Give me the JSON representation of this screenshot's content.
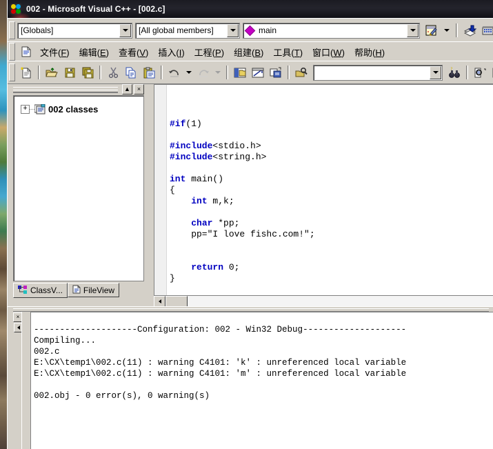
{
  "window": {
    "title": "002 - Microsoft Visual C++ - [002.c]",
    "icon": "vcpp-app-icon"
  },
  "combobar": {
    "scope_value": "[Globals]",
    "members_value": "[All global members]",
    "symbol_value": "main",
    "symbol_icon": "magenta-diamond-icon",
    "wizard_icon": "classwizard-icon",
    "arrow_icon": "chevron-down-icon"
  },
  "toolbar_right_top": {
    "buttons": [
      {
        "name": "compile-icon",
        "glyph": "compile"
      },
      {
        "name": "build-icon",
        "glyph": "build"
      },
      {
        "name": "execute-icon",
        "glyph": "execute"
      },
      {
        "name": "stop-build-icon",
        "glyph": "!"
      }
    ]
  },
  "menu": {
    "icon": "document-icon",
    "items": [
      {
        "label": "文件",
        "accel": "F"
      },
      {
        "label": "编辑",
        "accel": "E"
      },
      {
        "label": "查看",
        "accel": "V"
      },
      {
        "label": "插入",
        "accel": "I"
      },
      {
        "label": "工程",
        "accel": "P"
      },
      {
        "label": "组建",
        "accel": "B"
      },
      {
        "label": "工具",
        "accel": "T"
      },
      {
        "label": "窗口",
        "accel": "W"
      },
      {
        "label": "帮助",
        "accel": "H"
      }
    ]
  },
  "toolbar": {
    "buttons": [
      {
        "name": "new-file-icon"
      },
      {
        "name": "open-file-icon"
      },
      {
        "name": "save-icon"
      },
      {
        "name": "save-all-icon"
      },
      {
        "name": "cut-icon"
      },
      {
        "name": "copy-icon"
      },
      {
        "name": "paste-icon"
      },
      {
        "name": "undo-icon"
      },
      {
        "name": "undo-dropdown-icon"
      },
      {
        "name": "redo-icon"
      },
      {
        "name": "redo-dropdown-icon"
      },
      {
        "name": "workspace-toggle-icon"
      },
      {
        "name": "output-toggle-icon"
      },
      {
        "name": "watch-toggle-icon"
      },
      {
        "name": "find-in-files-icon"
      },
      {
        "name": "find-combo-dropdown-icon"
      },
      {
        "name": "find-binoculars-icon"
      },
      {
        "name": "breakpoint-insert-icon"
      },
      {
        "name": "breakpoint-remove-icon"
      },
      {
        "name": "bookmark-icon"
      },
      {
        "name": "properties-icon"
      }
    ],
    "find_placeholder": "",
    "find_value": ""
  },
  "workspace": {
    "close_label": "×",
    "pin_label": "▲",
    "tree": {
      "expander": "+",
      "icon": "classes-folder-icon",
      "label": "002 classes"
    },
    "tabs": [
      {
        "label": "ClassV...",
        "icon": "classview-icon",
        "active": true
      },
      {
        "label": "FileView",
        "icon": "fileview-icon",
        "active": false
      }
    ]
  },
  "editor": {
    "lines": [
      {
        "segments": [
          {
            "t": "",
            "c": "plain"
          }
        ]
      },
      {
        "segments": [
          {
            "t": "",
            "c": "plain"
          }
        ]
      },
      {
        "segments": [
          {
            "t": "#if",
            "c": "pp"
          },
          {
            "t": "(1)",
            "c": "plain"
          }
        ]
      },
      {
        "segments": [
          {
            "t": "",
            "c": "plain"
          }
        ]
      },
      {
        "segments": [
          {
            "t": "#include",
            "c": "pp"
          },
          {
            "t": "<stdio.h>",
            "c": "plain"
          }
        ]
      },
      {
        "segments": [
          {
            "t": "#include",
            "c": "pp"
          },
          {
            "t": "<string.h>",
            "c": "plain"
          }
        ]
      },
      {
        "segments": [
          {
            "t": "",
            "c": "plain"
          }
        ]
      },
      {
        "segments": [
          {
            "t": "int",
            "c": "kw"
          },
          {
            "t": " main()",
            "c": "plain"
          }
        ]
      },
      {
        "segments": [
          {
            "t": "{",
            "c": "plain"
          }
        ]
      },
      {
        "segments": [
          {
            "t": "    ",
            "c": "plain"
          },
          {
            "t": "int",
            "c": "kw"
          },
          {
            "t": " m,k;",
            "c": "plain"
          }
        ]
      },
      {
        "segments": [
          {
            "t": "",
            "c": "plain"
          }
        ]
      },
      {
        "segments": [
          {
            "t": "    ",
            "c": "plain"
          },
          {
            "t": "char",
            "c": "kw"
          },
          {
            "t": " *pp;",
            "c": "plain"
          }
        ]
      },
      {
        "segments": [
          {
            "t": "    pp=\"I love fishc.com!\";",
            "c": "plain"
          }
        ]
      },
      {
        "segments": [
          {
            "t": "",
            "c": "plain"
          }
        ]
      },
      {
        "segments": [
          {
            "t": "",
            "c": "plain"
          }
        ]
      },
      {
        "segments": [
          {
            "t": "    ",
            "c": "plain"
          },
          {
            "t": "return",
            "c": "kw"
          },
          {
            "t": " 0;",
            "c": "plain"
          }
        ]
      },
      {
        "segments": [
          {
            "t": "}",
            "c": "plain"
          }
        ]
      }
    ],
    "keyword_color": "#0000c0",
    "text_color": "#000000",
    "background": "#ffffff"
  },
  "output": {
    "close_label": "×",
    "lines": [
      "--------------------Configuration: 002 - Win32 Debug--------------------",
      "Compiling...",
      "002.c",
      "E:\\CX\\temp1\\002.c(11) : warning C4101: 'k' : unreferenced local variable",
      "E:\\CX\\temp1\\002.c(11) : warning C4101: 'm' : unreferenced local variable",
      "",
      "002.obj - 0 error(s), 0 warning(s)"
    ]
  },
  "colors": {
    "chrome": "#d4d0c8",
    "titlebar": "#1b1b22",
    "editor_bg": "#ffffff",
    "keyword": "#0000c0"
  }
}
